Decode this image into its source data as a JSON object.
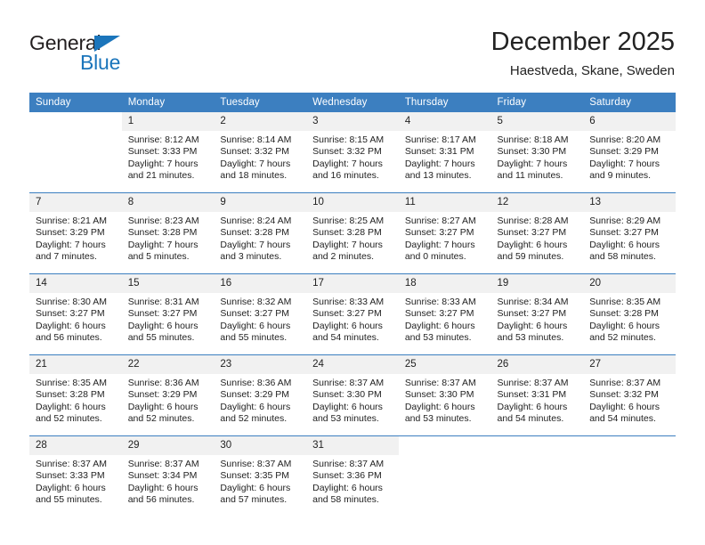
{
  "brand": {
    "name_part1": "General",
    "name_part2": "Blue",
    "accent_color": "#1b75bb"
  },
  "header": {
    "title": "December 2025",
    "subtitle": "Haestveda, Skane, Sweden"
  },
  "calendar": {
    "header_bg": "#3c7fc0",
    "daynum_bg": "#f1f1f1",
    "weekday_headers": [
      "Sunday",
      "Monday",
      "Tuesday",
      "Wednesday",
      "Thursday",
      "Friday",
      "Saturday"
    ],
    "weeks": [
      [
        {
          "day": "",
          "blank": true,
          "sunrise": "",
          "sunset": "",
          "daylight_line1": "",
          "daylight_line2": ""
        },
        {
          "day": "1",
          "blank": false,
          "sunrise": "Sunrise: 8:12 AM",
          "sunset": "Sunset: 3:33 PM",
          "daylight_line1": "Daylight: 7 hours",
          "daylight_line2": "and 21 minutes."
        },
        {
          "day": "2",
          "blank": false,
          "sunrise": "Sunrise: 8:14 AM",
          "sunset": "Sunset: 3:32 PM",
          "daylight_line1": "Daylight: 7 hours",
          "daylight_line2": "and 18 minutes."
        },
        {
          "day": "3",
          "blank": false,
          "sunrise": "Sunrise: 8:15 AM",
          "sunset": "Sunset: 3:32 PM",
          "daylight_line1": "Daylight: 7 hours",
          "daylight_line2": "and 16 minutes."
        },
        {
          "day": "4",
          "blank": false,
          "sunrise": "Sunrise: 8:17 AM",
          "sunset": "Sunset: 3:31 PM",
          "daylight_line1": "Daylight: 7 hours",
          "daylight_line2": "and 13 minutes."
        },
        {
          "day": "5",
          "blank": false,
          "sunrise": "Sunrise: 8:18 AM",
          "sunset": "Sunset: 3:30 PM",
          "daylight_line1": "Daylight: 7 hours",
          "daylight_line2": "and 11 minutes."
        },
        {
          "day": "6",
          "blank": false,
          "sunrise": "Sunrise: 8:20 AM",
          "sunset": "Sunset: 3:29 PM",
          "daylight_line1": "Daylight: 7 hours",
          "daylight_line2": "and 9 minutes."
        }
      ],
      [
        {
          "day": "7",
          "blank": false,
          "sunrise": "Sunrise: 8:21 AM",
          "sunset": "Sunset: 3:29 PM",
          "daylight_line1": "Daylight: 7 hours",
          "daylight_line2": "and 7 minutes."
        },
        {
          "day": "8",
          "blank": false,
          "sunrise": "Sunrise: 8:23 AM",
          "sunset": "Sunset: 3:28 PM",
          "daylight_line1": "Daylight: 7 hours",
          "daylight_line2": "and 5 minutes."
        },
        {
          "day": "9",
          "blank": false,
          "sunrise": "Sunrise: 8:24 AM",
          "sunset": "Sunset: 3:28 PM",
          "daylight_line1": "Daylight: 7 hours",
          "daylight_line2": "and 3 minutes."
        },
        {
          "day": "10",
          "blank": false,
          "sunrise": "Sunrise: 8:25 AM",
          "sunset": "Sunset: 3:28 PM",
          "daylight_line1": "Daylight: 7 hours",
          "daylight_line2": "and 2 minutes."
        },
        {
          "day": "11",
          "blank": false,
          "sunrise": "Sunrise: 8:27 AM",
          "sunset": "Sunset: 3:27 PM",
          "daylight_line1": "Daylight: 7 hours",
          "daylight_line2": "and 0 minutes."
        },
        {
          "day": "12",
          "blank": false,
          "sunrise": "Sunrise: 8:28 AM",
          "sunset": "Sunset: 3:27 PM",
          "daylight_line1": "Daylight: 6 hours",
          "daylight_line2": "and 59 minutes."
        },
        {
          "day": "13",
          "blank": false,
          "sunrise": "Sunrise: 8:29 AM",
          "sunset": "Sunset: 3:27 PM",
          "daylight_line1": "Daylight: 6 hours",
          "daylight_line2": "and 58 minutes."
        }
      ],
      [
        {
          "day": "14",
          "blank": false,
          "sunrise": "Sunrise: 8:30 AM",
          "sunset": "Sunset: 3:27 PM",
          "daylight_line1": "Daylight: 6 hours",
          "daylight_line2": "and 56 minutes."
        },
        {
          "day": "15",
          "blank": false,
          "sunrise": "Sunrise: 8:31 AM",
          "sunset": "Sunset: 3:27 PM",
          "daylight_line1": "Daylight: 6 hours",
          "daylight_line2": "and 55 minutes."
        },
        {
          "day": "16",
          "blank": false,
          "sunrise": "Sunrise: 8:32 AM",
          "sunset": "Sunset: 3:27 PM",
          "daylight_line1": "Daylight: 6 hours",
          "daylight_line2": "and 55 minutes."
        },
        {
          "day": "17",
          "blank": false,
          "sunrise": "Sunrise: 8:33 AM",
          "sunset": "Sunset: 3:27 PM",
          "daylight_line1": "Daylight: 6 hours",
          "daylight_line2": "and 54 minutes."
        },
        {
          "day": "18",
          "blank": false,
          "sunrise": "Sunrise: 8:33 AM",
          "sunset": "Sunset: 3:27 PM",
          "daylight_line1": "Daylight: 6 hours",
          "daylight_line2": "and 53 minutes."
        },
        {
          "day": "19",
          "blank": false,
          "sunrise": "Sunrise: 8:34 AM",
          "sunset": "Sunset: 3:27 PM",
          "daylight_line1": "Daylight: 6 hours",
          "daylight_line2": "and 53 minutes."
        },
        {
          "day": "20",
          "blank": false,
          "sunrise": "Sunrise: 8:35 AM",
          "sunset": "Sunset: 3:28 PM",
          "daylight_line1": "Daylight: 6 hours",
          "daylight_line2": "and 52 minutes."
        }
      ],
      [
        {
          "day": "21",
          "blank": false,
          "sunrise": "Sunrise: 8:35 AM",
          "sunset": "Sunset: 3:28 PM",
          "daylight_line1": "Daylight: 6 hours",
          "daylight_line2": "and 52 minutes."
        },
        {
          "day": "22",
          "blank": false,
          "sunrise": "Sunrise: 8:36 AM",
          "sunset": "Sunset: 3:29 PM",
          "daylight_line1": "Daylight: 6 hours",
          "daylight_line2": "and 52 minutes."
        },
        {
          "day": "23",
          "blank": false,
          "sunrise": "Sunrise: 8:36 AM",
          "sunset": "Sunset: 3:29 PM",
          "daylight_line1": "Daylight: 6 hours",
          "daylight_line2": "and 52 minutes."
        },
        {
          "day": "24",
          "blank": false,
          "sunrise": "Sunrise: 8:37 AM",
          "sunset": "Sunset: 3:30 PM",
          "daylight_line1": "Daylight: 6 hours",
          "daylight_line2": "and 53 minutes."
        },
        {
          "day": "25",
          "blank": false,
          "sunrise": "Sunrise: 8:37 AM",
          "sunset": "Sunset: 3:30 PM",
          "daylight_line1": "Daylight: 6 hours",
          "daylight_line2": "and 53 minutes."
        },
        {
          "day": "26",
          "blank": false,
          "sunrise": "Sunrise: 8:37 AM",
          "sunset": "Sunset: 3:31 PM",
          "daylight_line1": "Daylight: 6 hours",
          "daylight_line2": "and 54 minutes."
        },
        {
          "day": "27",
          "blank": false,
          "sunrise": "Sunrise: 8:37 AM",
          "sunset": "Sunset: 3:32 PM",
          "daylight_line1": "Daylight: 6 hours",
          "daylight_line2": "and 54 minutes."
        }
      ],
      [
        {
          "day": "28",
          "blank": false,
          "sunrise": "Sunrise: 8:37 AM",
          "sunset": "Sunset: 3:33 PM",
          "daylight_line1": "Daylight: 6 hours",
          "daylight_line2": "and 55 minutes."
        },
        {
          "day": "29",
          "blank": false,
          "sunrise": "Sunrise: 8:37 AM",
          "sunset": "Sunset: 3:34 PM",
          "daylight_line1": "Daylight: 6 hours",
          "daylight_line2": "and 56 minutes."
        },
        {
          "day": "30",
          "blank": false,
          "sunrise": "Sunrise: 8:37 AM",
          "sunset": "Sunset: 3:35 PM",
          "daylight_line1": "Daylight: 6 hours",
          "daylight_line2": "and 57 minutes."
        },
        {
          "day": "31",
          "blank": false,
          "sunrise": "Sunrise: 8:37 AM",
          "sunset": "Sunset: 3:36 PM",
          "daylight_line1": "Daylight: 6 hours",
          "daylight_line2": "and 58 minutes."
        },
        {
          "day": "",
          "blank": true,
          "sunrise": "",
          "sunset": "",
          "daylight_line1": "",
          "daylight_line2": ""
        },
        {
          "day": "",
          "blank": true,
          "sunrise": "",
          "sunset": "",
          "daylight_line1": "",
          "daylight_line2": ""
        },
        {
          "day": "",
          "blank": true,
          "sunrise": "",
          "sunset": "",
          "daylight_line1": "",
          "daylight_line2": ""
        }
      ]
    ]
  }
}
